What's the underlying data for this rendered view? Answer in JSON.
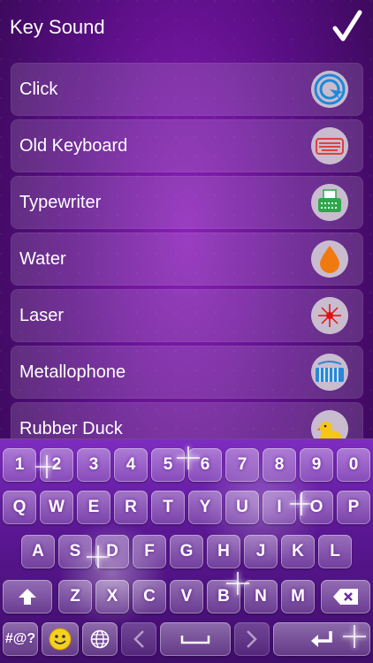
{
  "header": {
    "title": "Key Sound",
    "confirm_icon": "checkmark-icon"
  },
  "sounds": [
    {
      "label": "Click",
      "icon": "click-target-icon"
    },
    {
      "label": "Old Keyboard",
      "icon": "old-keyboard-icon"
    },
    {
      "label": "Typewriter",
      "icon": "typewriter-icon"
    },
    {
      "label": "Water",
      "icon": "water-drop-icon"
    },
    {
      "label": "Laser",
      "icon": "laser-icon"
    },
    {
      "label": "Metallophone",
      "icon": "metallophone-icon"
    },
    {
      "label": "Rubber Duck",
      "icon": "rubber-duck-icon"
    }
  ],
  "keyboard": {
    "row1": [
      "1",
      "2",
      "3",
      "4",
      "5",
      "6",
      "7",
      "8",
      "9",
      "0"
    ],
    "row2": [
      "Q",
      "W",
      "E",
      "R",
      "T",
      "Y",
      "U",
      "I",
      "O",
      "P"
    ],
    "row3": [
      "A",
      "S",
      "D",
      "F",
      "G",
      "H",
      "J",
      "K",
      "L"
    ],
    "row4": [
      "Z",
      "X",
      "C",
      "V",
      "B",
      "N",
      "M"
    ],
    "symbols_label": "#@?",
    "shift_icon": "shift-arrow-icon",
    "backspace_icon": "backspace-icon",
    "emoji_icon": "smiley-icon",
    "globe_icon": "globe-icon",
    "space_icon": "space-bar-icon",
    "return_icon": "return-arrow-icon",
    "left_arrow_icon": "chevron-left-icon",
    "right_arrow_icon": "chevron-right-icon"
  },
  "colors": {
    "background": "#5b0f86",
    "row": "rgba(255,255,255,0.14)",
    "icon_bg": "#c9bccf"
  }
}
